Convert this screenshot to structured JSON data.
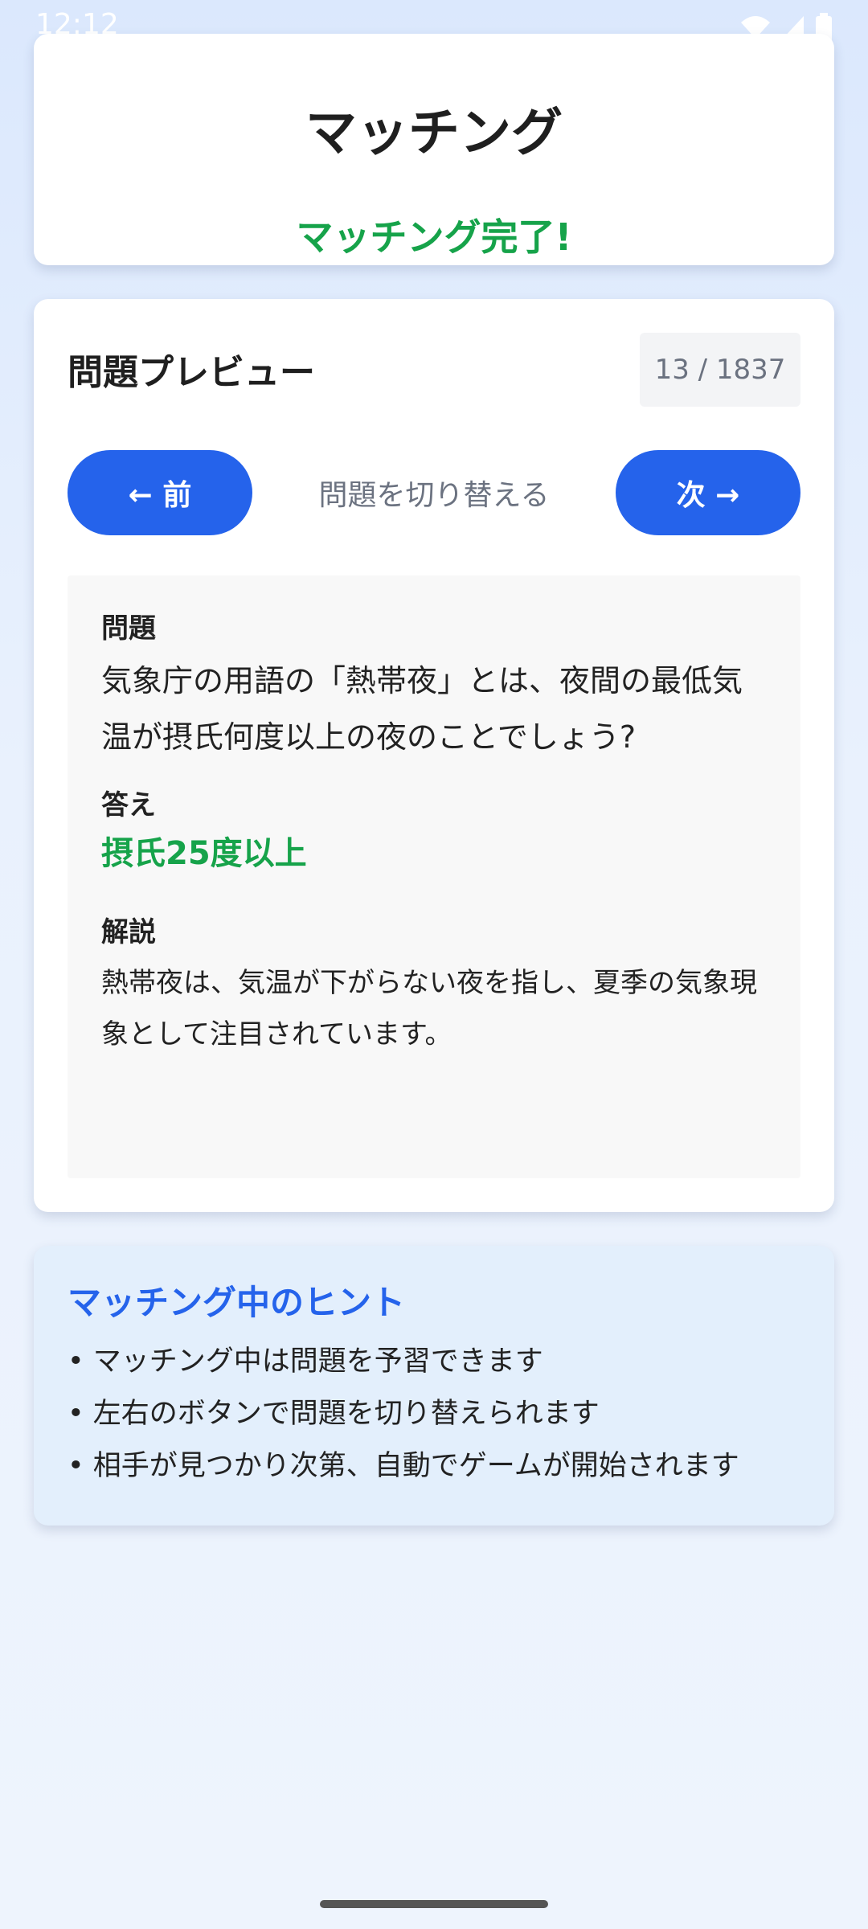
{
  "status_bar": {
    "time": "12:12"
  },
  "header": {
    "title": "マッチング",
    "status": "マッチング完了!"
  },
  "preview": {
    "title": "問題プレビュー",
    "counter": "13 / 1837",
    "prev_label": "← 前",
    "next_label": "次 →",
    "switch_hint": "問題を切り替える",
    "question_label": "問題",
    "question_text": "気象庁の用語の「熱帯夜」とは、夜間の最低気温が摂氏何度以上の夜のことでしょう?",
    "answer_label": "答え",
    "answer_text": "摂氏25度以上",
    "explanation_label": "解説",
    "explanation_text": "熱帯夜は、気温が下がらない夜を指し、夏季の気象現象として注目されています。"
  },
  "hints": {
    "title": "マッチング中のヒント",
    "items": [
      "• マッチング中は問題を予習できます",
      "• 左右のボタンで問題を切り替えられます",
      "• 相手が見つかり次第、自動でゲームが開始されます"
    ]
  },
  "colors": {
    "accent": "#2563eb",
    "success": "#16a34a",
    "hint_bg": "#e3effc"
  }
}
